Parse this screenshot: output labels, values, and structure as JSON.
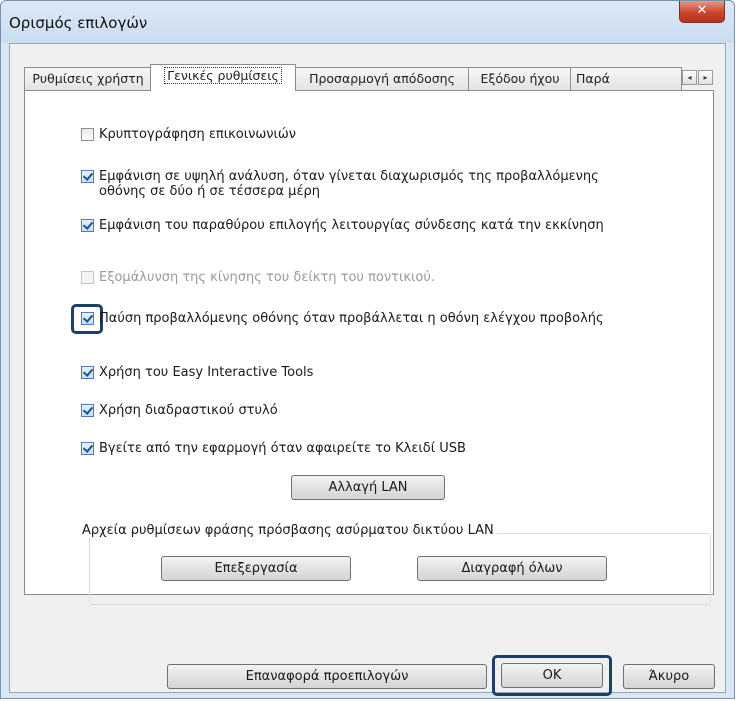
{
  "window": {
    "title": "Ορισμός επιλογών",
    "close_glyph": "✕"
  },
  "tabs": [
    {
      "label": "Ρυθμίσεις χρήστη",
      "active": false
    },
    {
      "label": "Γενικές ρυθμίσεις",
      "active": true
    },
    {
      "label": "Προσαρμογή απόδοσης",
      "active": false
    },
    {
      "label": "Εξόδου ήχου",
      "active": false
    },
    {
      "label": "Παρά",
      "active": false
    }
  ],
  "tab_scroll": {
    "left": "◂",
    "right": "▸"
  },
  "options": [
    {
      "label": "Κρυπτογράφηση επικοινωνιών",
      "checked": false,
      "enabled": true
    },
    {
      "label": "Εμφάνιση σε υψηλή ανάλυση, όταν γίνεται διαχωρισμός της προβαλλόμενης",
      "label2": "οθόνης σε δύο ή σε τέσσερα μέρη",
      "checked": true,
      "enabled": true
    },
    {
      "label": "Εμφάνιση του παραθύρου επιλογής λειτουργίας σύνδεσης κατά την εκκίνηση",
      "checked": true,
      "enabled": true
    },
    {
      "label": "Εξομάλυνση της κίνησης του δείκτη του ποντικιού.",
      "checked": false,
      "enabled": false
    },
    {
      "label": "Παύση προβαλλόμενης οθόνης όταν προβάλλεται η οθόνη ελέγχου προβολής",
      "checked": true,
      "enabled": true
    },
    {
      "label": "Χρήση του Easy Interactive Tools",
      "checked": true,
      "enabled": true
    },
    {
      "label": "Χρήση διαδραστικού στυλό",
      "checked": true,
      "enabled": true
    },
    {
      "label": "Βγείτε από την εφαρμογή όταν αφαιρείτε το Κλειδί USB",
      "checked": true,
      "enabled": true
    }
  ],
  "buttons": {
    "change_lan": "Αλλαγή LAN",
    "edit": "Επεξεργασία",
    "delete_all": "Διαγραφή όλων",
    "reset_defaults": "Επαναφορά προεπιλογών",
    "ok": "OK",
    "cancel": "Άκυρο"
  },
  "group": {
    "label": "Αρχεία ρυθμίσεων φράσης πρόσβασης ασύρματου δικτύου LAN"
  },
  "colors": {
    "accent_highlight": "#1d3e66",
    "close_red": "#c9452d"
  }
}
